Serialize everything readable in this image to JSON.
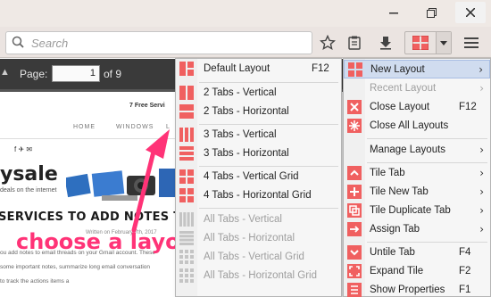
{
  "browser": {
    "search_placeholder": "Search",
    "window_buttons": [
      "minimize-icon",
      "restore-icon",
      "close-icon"
    ]
  },
  "pdf": {
    "page_label": "Page:",
    "page_value": "1",
    "page_of": "of 9"
  },
  "webpage": {
    "free_services": "7 Free Servi",
    "nav": [
      "HOME",
      "WINDOWS",
      "L"
    ],
    "social": "f  ✈  ✉",
    "logo": "ysale",
    "logo_sub": "deals on the internet",
    "headline": "SERVICES TO ADD NOTES TO GMAIL E",
    "byline": "Written on February 7th, 2017",
    "para1": "ou add notes to email threads on your Gmail account. These",
    "para2": "some important notes, summarize long email conversation",
    "para3": "to track the actions items a"
  },
  "annotation": {
    "text": "choose a layout",
    "color": "#ff3377"
  },
  "menus": {
    "main": [
      {
        "label": "New Layout",
        "icon": "layout-grid-icon",
        "submenu": true,
        "highlight": true
      },
      {
        "label": "Recent Layout",
        "icon": "blank-icon",
        "submenu": true,
        "disabled": true
      },
      {
        "label": "Close Layout",
        "icon": "close-layout-icon",
        "accel": "F12"
      },
      {
        "label": "Close All Layouts",
        "icon": "close-all-layouts-icon"
      },
      {
        "label": "Manage Layouts",
        "icon": "blank-icon",
        "submenu": true
      },
      {
        "label": "Tile Tab",
        "icon": "tile-tab-icon",
        "submenu": true
      },
      {
        "label": "Tile New Tab",
        "icon": "tile-new-tab-icon",
        "submenu": true
      },
      {
        "label": "Tile Duplicate Tab",
        "icon": "tile-duplicate-tab-icon",
        "submenu": true
      },
      {
        "label": "Assign Tab",
        "icon": "assign-tab-icon",
        "submenu": true
      },
      {
        "label": "Untile Tab",
        "icon": "untile-tab-icon",
        "accel": "F4"
      },
      {
        "label": "Expand Tile",
        "icon": "expand-tile-icon",
        "accel": "F2"
      },
      {
        "label": "Show Properties",
        "icon": "properties-icon",
        "accel": "F1"
      }
    ],
    "layouts": [
      {
        "label": "Default Layout",
        "icon": "default-layout-icon",
        "accel": "F12"
      },
      {
        "label": "2 Tabs - Vertical",
        "icon": "two-vertical-icon"
      },
      {
        "label": "2 Tabs - Horizontal",
        "icon": "two-horizontal-icon"
      },
      {
        "label": "3 Tabs - Vertical",
        "icon": "three-vertical-icon"
      },
      {
        "label": "3 Tabs - Horizontal",
        "icon": "three-horizontal-icon"
      },
      {
        "label": "4 Tabs - Vertical Grid",
        "icon": "four-vertical-grid-icon"
      },
      {
        "label": "4 Tabs - Horizontal Grid",
        "icon": "four-horizontal-grid-icon"
      },
      {
        "label": "All Tabs - Vertical",
        "icon": "all-vertical-icon",
        "disabled": true
      },
      {
        "label": "All Tabs - Horizontal",
        "icon": "all-horizontal-icon",
        "disabled": true
      },
      {
        "label": "All Tabs - Vertical Grid",
        "icon": "all-vertical-grid-icon",
        "disabled": true
      },
      {
        "label": "All Tabs - Horizontal Grid",
        "icon": "all-horizontal-grid-icon",
        "disabled": true
      }
    ]
  },
  "colors": {
    "accent_red": "#f06060",
    "disabled_gray": "#b8b8b8"
  }
}
